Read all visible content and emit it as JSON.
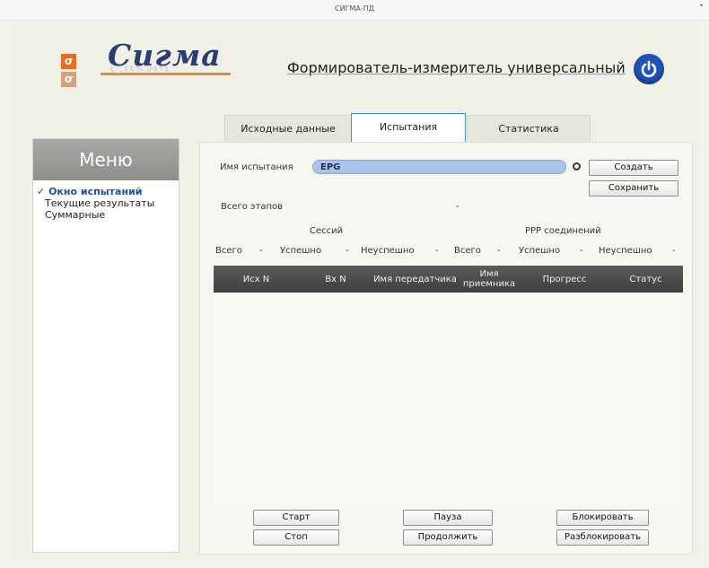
{
  "window": {
    "title": "СИГМА-ПД"
  },
  "header": {
    "logo_glyph": "σ",
    "brand": "Сигма",
    "subtitle": "Формирователь-измеритель универсальный",
    "accent_color": "#1f55b8"
  },
  "menu": {
    "title": "Меню",
    "items": [
      {
        "label": "Окно испытаний",
        "checkmark": "✓",
        "active": true
      },
      {
        "label": "Текущие результаты",
        "active": false
      },
      {
        "label": "Суммарные",
        "active": false
      }
    ]
  },
  "tabs": [
    {
      "label": "Исходные данные",
      "active": false
    },
    {
      "label": "Испытания",
      "active": true
    },
    {
      "label": "Статистика",
      "active": false
    }
  ],
  "test_form": {
    "name_label": "Имя испытания",
    "name_value": "EPG",
    "create_button": "Создать",
    "save_button": "Сохранить",
    "total_stages_label": "Всего этапов",
    "total_stages_value": "-"
  },
  "stats": {
    "sessions_heading": "Сессий",
    "ppp_heading": "PPP соединений",
    "row": [
      {
        "label": "Всего",
        "value": "-"
      },
      {
        "label": "Успешно",
        "value": "-"
      },
      {
        "label": "Неуспешно",
        "value": "-"
      },
      {
        "label": "Всего",
        "value": "-"
      },
      {
        "label": "Успешно",
        "value": "-"
      },
      {
        "label": "Неуспешно",
        "value": "-"
      }
    ]
  },
  "table": {
    "columns": [
      "Исх N",
      "Вх N",
      "Имя передатчика",
      "Имя приемника",
      "Прогресс",
      "Статус"
    ],
    "rows": []
  },
  "controls": {
    "start": "Старт",
    "stop": "Стоп",
    "pause": "Пауза",
    "resume": "Продолжить",
    "block": "Блокировать",
    "unblock": "Разблокировать"
  }
}
